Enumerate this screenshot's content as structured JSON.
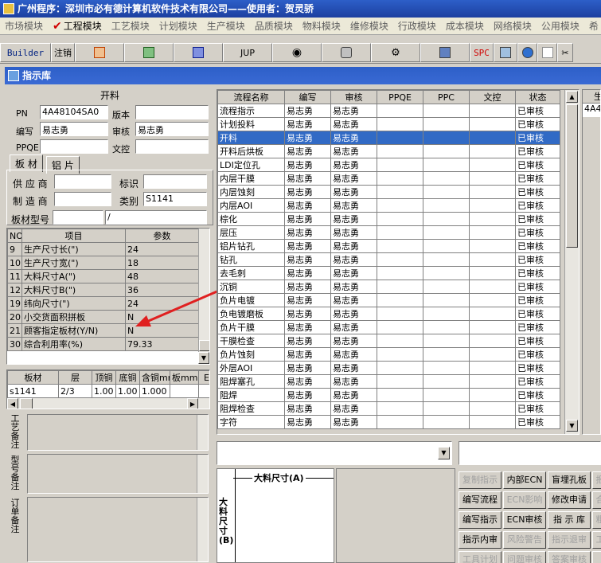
{
  "app": {
    "title": "广州程序：深圳市必有德计算机软件技术有限公司——使用者：贺灵骄"
  },
  "menu": [
    "市场模块",
    "工程模块",
    "工艺模块",
    "计划模块",
    "生产模块",
    "品质模块",
    "物料模块",
    "维修模块",
    "行政模块",
    "成本模块",
    "网络模块",
    "公用模块",
    "希"
  ],
  "toolbar": {
    "builder": "Builder",
    "logout": "注销",
    "jup": "JUP",
    "spc": "SPC"
  },
  "window": {
    "title": "指示库"
  },
  "left": {
    "section_title": "开料",
    "pn_label": "PN",
    "pn_value": "4A48104SA0",
    "version_label": "版本",
    "version_value": "",
    "author_label": "编写",
    "author_value": "易志勇",
    "review_label": "审核",
    "review_value": "易志勇",
    "ppqe_label": "PPQE",
    "ppqe_value": "",
    "doc_label": "文控",
    "doc_value": "",
    "tabs": [
      "板 材",
      "铝 片"
    ],
    "supplier_label": "供 应 商",
    "supplier_value": "",
    "mark_label": "标识",
    "mark_value": "",
    "maker_label": "制 造 商",
    "maker_value": "",
    "category_label": "类别",
    "category_value": "S1141",
    "model_label": "板材型号",
    "model_value": "",
    "model_value2": "/",
    "param_headers": [
      "NO",
      "项目",
      "参数"
    ],
    "params": [
      {
        "no": "9",
        "item": "生产尺寸长(\")",
        "value": "24"
      },
      {
        "no": "10",
        "item": "生产尺寸宽(\")",
        "value": "18"
      },
      {
        "no": "11",
        "item": "大料尺寸A(\")",
        "value": "48"
      },
      {
        "no": "12",
        "item": "大料尺寸B(\")",
        "value": "36"
      },
      {
        "no": "19",
        "item": "纬向尺寸(\")",
        "value": "24"
      },
      {
        "no": "20",
        "item": "小交货面积拼板",
        "value": "N"
      },
      {
        "no": "21",
        "item": "顾客指定板材(Y/N)",
        "value": "N"
      },
      {
        "no": "30",
        "item": "综合利用率(%)",
        "value": "79.33"
      }
    ],
    "mat_headers": [
      "板材",
      "层",
      "顶铜",
      "底铜",
      "含铜mm",
      "板mm",
      "E"
    ],
    "mat_rows": [
      [
        "s1141",
        "2/3",
        "1.00",
        "1.00",
        "1.000",
        "",
        ""
      ]
    ],
    "notes": [
      {
        "label": "工艺备注"
      },
      {
        "label": "型号备注"
      },
      {
        "label": "订单备注"
      }
    ]
  },
  "flow": {
    "headers": [
      "流程名称",
      "编写",
      "审核",
      "PPQE",
      "PPC",
      "文控",
      "状态"
    ],
    "rows": [
      {
        "name": "流程指示",
        "author": "易志勇",
        "review": "易志勇",
        "status": "已审核"
      },
      {
        "name": "计划投料",
        "author": "易志勇",
        "review": "易志勇",
        "status": "已审核"
      },
      {
        "name": "开料",
        "author": "易志勇",
        "review": "易志勇",
        "status": "已审核"
      },
      {
        "name": "开料后烘板",
        "author": "易志勇",
        "review": "易志勇",
        "status": "已审核"
      },
      {
        "name": "LDI定位孔",
        "author": "易志勇",
        "review": "易志勇",
        "status": "已审核"
      },
      {
        "name": "内层干膜",
        "author": "易志勇",
        "review": "易志勇",
        "status": "已审核"
      },
      {
        "name": "内层蚀刻",
        "author": "易志勇",
        "review": "易志勇",
        "status": "已审核"
      },
      {
        "name": "内层AOI",
        "author": "易志勇",
        "review": "易志勇",
        "status": "已审核"
      },
      {
        "name": "棕化",
        "author": "易志勇",
        "review": "易志勇",
        "status": "已审核"
      },
      {
        "name": "层压",
        "author": "易志勇",
        "review": "易志勇",
        "status": "已审核"
      },
      {
        "name": "铝片钻孔",
        "author": "易志勇",
        "review": "易志勇",
        "status": "已审核"
      },
      {
        "name": "钻孔",
        "author": "易志勇",
        "review": "易志勇",
        "status": "已审核"
      },
      {
        "name": "去毛刺",
        "author": "易志勇",
        "review": "易志勇",
        "status": "已审核"
      },
      {
        "name": "沉铜",
        "author": "易志勇",
        "review": "易志勇",
        "status": "已审核"
      },
      {
        "name": "负片电镀",
        "author": "易志勇",
        "review": "易志勇",
        "status": "已审核"
      },
      {
        "name": "负电镀磨板",
        "author": "易志勇",
        "review": "易志勇",
        "status": "已审核"
      },
      {
        "name": "负片干膜",
        "author": "易志勇",
        "review": "易志勇",
        "status": "已审核"
      },
      {
        "name": "干膜检查",
        "author": "易志勇",
        "review": "易志勇",
        "status": "已审核"
      },
      {
        "name": "负片蚀刻",
        "author": "易志勇",
        "review": "易志勇",
        "status": "已审核"
      },
      {
        "name": "外层AOI",
        "author": "易志勇",
        "review": "易志勇",
        "status": "已审核"
      },
      {
        "name": "阻焊塞孔",
        "author": "易志勇",
        "review": "易志勇",
        "status": "已审核"
      },
      {
        "name": "阻焊",
        "author": "易志勇",
        "review": "易志勇",
        "status": "已审核"
      },
      {
        "name": "阻焊检查",
        "author": "易志勇",
        "review": "易志勇",
        "status": "已审核"
      },
      {
        "name": "字符",
        "author": "易志勇",
        "review": "易志勇",
        "status": "已审核"
      }
    ],
    "selected_index": 2
  },
  "right_panel": {
    "header": "生",
    "value": "4A4"
  },
  "diagram": {
    "a_label": "大料尺寸(A)",
    "b_label": "大料尺寸(B)"
  },
  "buttons": [
    {
      "label": "复制指示",
      "enabled": false
    },
    {
      "label": "内部ECN",
      "enabled": true
    },
    {
      "label": "盲埋孔板",
      "enabled": true
    },
    {
      "label": "报",
      "enabled": false
    },
    {
      "label": "编写流程",
      "enabled": true
    },
    {
      "label": "ECN影响",
      "enabled": false
    },
    {
      "label": "修改申请",
      "enabled": true
    },
    {
      "label": "合",
      "enabled": false
    },
    {
      "label": "编写指示",
      "enabled": true
    },
    {
      "label": "ECN审核",
      "enabled": true
    },
    {
      "label": "指 示 库",
      "enabled": true
    },
    {
      "label": "粗",
      "enabled": false
    },
    {
      "label": "指示内审",
      "enabled": true
    },
    {
      "label": "风险警告",
      "enabled": false
    },
    {
      "label": "指示退审",
      "enabled": false
    },
    {
      "label": "工",
      "enabled": false
    },
    {
      "label": "工具计划",
      "enabled": false
    },
    {
      "label": "问题审核",
      "enabled": false
    },
    {
      "label": "答案审核",
      "enabled": false
    },
    {
      "label": "",
      "enabled": false
    }
  ],
  "colors": {
    "title_bar": "#1c3fa0",
    "selection": "#316ac5",
    "arrow": "#e02020"
  }
}
